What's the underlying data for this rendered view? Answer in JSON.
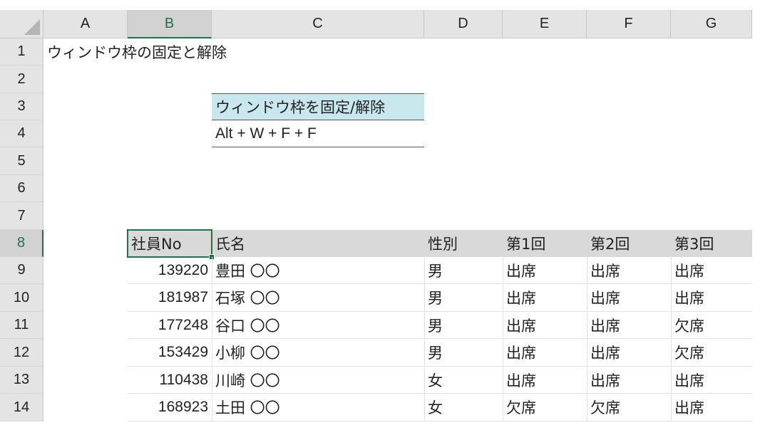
{
  "columns": [
    "A",
    "B",
    "C",
    "D",
    "E",
    "F",
    "G"
  ],
  "rows": [
    "1",
    "2",
    "3",
    "4",
    "5",
    "6",
    "7",
    "8",
    "9",
    "10",
    "11",
    "12",
    "13",
    "14"
  ],
  "title_cell": "ウィンドウ枠の固定と解除",
  "shortcut": {
    "header": "ウィンドウ枠を固定/解除",
    "keys": "Alt + W + F + F"
  },
  "table": {
    "headers": [
      "社員No",
      "氏名",
      "性別",
      "第1回",
      "第2回",
      "第3回"
    ],
    "rows": [
      [
        "139220",
        "豊田 〇〇",
        "男",
        "出席",
        "出席",
        "出席"
      ],
      [
        "181987",
        "石塚 〇〇",
        "男",
        "出席",
        "出席",
        "出席"
      ],
      [
        "177248",
        "谷口 〇〇",
        "男",
        "出席",
        "出席",
        "欠席"
      ],
      [
        "153429",
        "小柳 〇〇",
        "男",
        "出席",
        "出席",
        "欠席"
      ],
      [
        "110438",
        "川崎 〇〇",
        "女",
        "出席",
        "出席",
        "出席"
      ],
      [
        "168923",
        "土田 〇〇",
        "女",
        "欠席",
        "欠席",
        "出席"
      ]
    ]
  },
  "selection": {
    "column": "B",
    "row": "8"
  },
  "colors": {
    "accent": "#217346",
    "shortcut_fill": "#c9e8ee",
    "header_fill": "#d9d9d9"
  }
}
